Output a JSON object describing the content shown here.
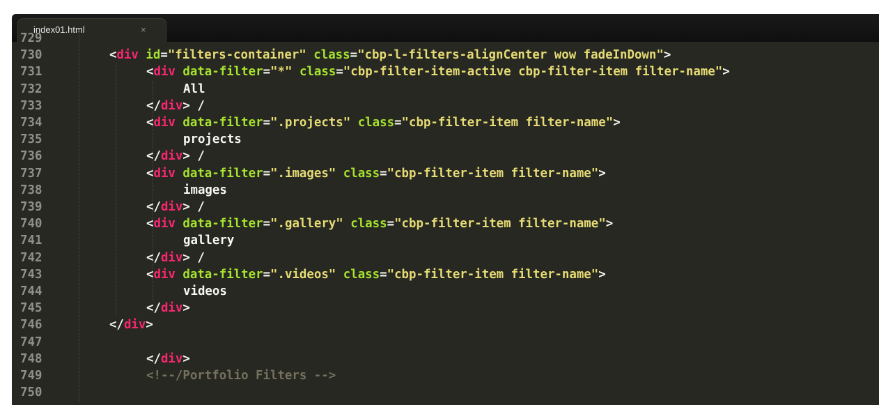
{
  "tab": {
    "title": "index01.html",
    "close": "×"
  },
  "editor": {
    "lines": [
      {
        "num": "729",
        "indent": 0,
        "tokens": []
      },
      {
        "num": "730",
        "indent": 1,
        "tokens": [
          {
            "t": "<",
            "c": "txt"
          },
          {
            "t": "div",
            "c": "tag"
          },
          {
            "t": " ",
            "c": "txt"
          },
          {
            "t": "id",
            "c": "attr"
          },
          {
            "t": "=",
            "c": "txt"
          },
          {
            "t": "\"filters-container\"",
            "c": "str"
          },
          {
            "t": " ",
            "c": "txt"
          },
          {
            "t": "class",
            "c": "attr"
          },
          {
            "t": "=",
            "c": "txt"
          },
          {
            "t": "\"cbp-l-filters-alignCenter wow fadeInDown\"",
            "c": "str"
          },
          {
            "t": ">",
            "c": "txt"
          }
        ]
      },
      {
        "num": "731",
        "indent": 2,
        "tokens": [
          {
            "t": "<",
            "c": "txt"
          },
          {
            "t": "div",
            "c": "tag"
          },
          {
            "t": " ",
            "c": "txt"
          },
          {
            "t": "data-filter",
            "c": "attr"
          },
          {
            "t": "=",
            "c": "txt"
          },
          {
            "t": "\"*\"",
            "c": "str"
          },
          {
            "t": " ",
            "c": "txt"
          },
          {
            "t": "class",
            "c": "attr"
          },
          {
            "t": "=",
            "c": "txt"
          },
          {
            "t": "\"cbp-filter-item-active cbp-filter-item filter-name\"",
            "c": "str"
          },
          {
            "t": ">",
            "c": "txt"
          }
        ]
      },
      {
        "num": "732",
        "indent": 3,
        "tokens": [
          {
            "t": "All",
            "c": "txt"
          }
        ]
      },
      {
        "num": "733",
        "indent": 2,
        "tokens": [
          {
            "t": "</",
            "c": "txt"
          },
          {
            "t": "div",
            "c": "tag"
          },
          {
            "t": "> /",
            "c": "txt"
          }
        ]
      },
      {
        "num": "734",
        "indent": 2,
        "tokens": [
          {
            "t": "<",
            "c": "txt"
          },
          {
            "t": "div",
            "c": "tag"
          },
          {
            "t": " ",
            "c": "txt"
          },
          {
            "t": "data-filter",
            "c": "attr"
          },
          {
            "t": "=",
            "c": "txt"
          },
          {
            "t": "\".projects\"",
            "c": "str"
          },
          {
            "t": " ",
            "c": "txt"
          },
          {
            "t": "class",
            "c": "attr"
          },
          {
            "t": "=",
            "c": "txt"
          },
          {
            "t": "\"cbp-filter-item filter-name\"",
            "c": "str"
          },
          {
            "t": ">",
            "c": "txt"
          }
        ]
      },
      {
        "num": "735",
        "indent": 3,
        "tokens": [
          {
            "t": "projects",
            "c": "txt"
          }
        ]
      },
      {
        "num": "736",
        "indent": 2,
        "tokens": [
          {
            "t": "</",
            "c": "txt"
          },
          {
            "t": "div",
            "c": "tag"
          },
          {
            "t": "> /",
            "c": "txt"
          }
        ]
      },
      {
        "num": "737",
        "indent": 2,
        "tokens": [
          {
            "t": "<",
            "c": "txt"
          },
          {
            "t": "div",
            "c": "tag"
          },
          {
            "t": " ",
            "c": "txt"
          },
          {
            "t": "data-filter",
            "c": "attr"
          },
          {
            "t": "=",
            "c": "txt"
          },
          {
            "t": "\".images\"",
            "c": "str"
          },
          {
            "t": " ",
            "c": "txt"
          },
          {
            "t": "class",
            "c": "attr"
          },
          {
            "t": "=",
            "c": "txt"
          },
          {
            "t": "\"cbp-filter-item filter-name\"",
            "c": "str"
          },
          {
            "t": ">",
            "c": "txt"
          }
        ]
      },
      {
        "num": "738",
        "indent": 3,
        "tokens": [
          {
            "t": "images",
            "c": "txt"
          }
        ]
      },
      {
        "num": "739",
        "indent": 2,
        "tokens": [
          {
            "t": "</",
            "c": "txt"
          },
          {
            "t": "div",
            "c": "tag"
          },
          {
            "t": "> /",
            "c": "txt"
          }
        ]
      },
      {
        "num": "740",
        "indent": 2,
        "tokens": [
          {
            "t": "<",
            "c": "txt"
          },
          {
            "t": "div",
            "c": "tag"
          },
          {
            "t": " ",
            "c": "txt"
          },
          {
            "t": "data-filter",
            "c": "attr"
          },
          {
            "t": "=",
            "c": "txt"
          },
          {
            "t": "\".gallery\"",
            "c": "str"
          },
          {
            "t": " ",
            "c": "txt"
          },
          {
            "t": "class",
            "c": "attr"
          },
          {
            "t": "=",
            "c": "txt"
          },
          {
            "t": "\"cbp-filter-item filter-name\"",
            "c": "str"
          },
          {
            "t": ">",
            "c": "txt"
          }
        ]
      },
      {
        "num": "741",
        "indent": 3,
        "tokens": [
          {
            "t": "gallery",
            "c": "txt"
          }
        ]
      },
      {
        "num": "742",
        "indent": 2,
        "tokens": [
          {
            "t": "</",
            "c": "txt"
          },
          {
            "t": "div",
            "c": "tag"
          },
          {
            "t": "> /",
            "c": "txt"
          }
        ]
      },
      {
        "num": "743",
        "indent": 2,
        "tokens": [
          {
            "t": "<",
            "c": "txt"
          },
          {
            "t": "div",
            "c": "tag"
          },
          {
            "t": " ",
            "c": "txt"
          },
          {
            "t": "data-filter",
            "c": "attr"
          },
          {
            "t": "=",
            "c": "txt"
          },
          {
            "t": "\".videos\"",
            "c": "str"
          },
          {
            "t": " ",
            "c": "txt"
          },
          {
            "t": "class",
            "c": "attr"
          },
          {
            "t": "=",
            "c": "txt"
          },
          {
            "t": "\"cbp-filter-item filter-name\"",
            "c": "str"
          },
          {
            "t": ">",
            "c": "txt"
          }
        ]
      },
      {
        "num": "744",
        "indent": 3,
        "tokens": [
          {
            "t": "videos",
            "c": "txt"
          }
        ]
      },
      {
        "num": "745",
        "indent": 2,
        "tokens": [
          {
            "t": "</",
            "c": "txt"
          },
          {
            "t": "div",
            "c": "tag"
          },
          {
            "t": ">",
            "c": "txt"
          }
        ]
      },
      {
        "num": "746",
        "indent": 1,
        "tokens": [
          {
            "t": "</",
            "c": "txt"
          },
          {
            "t": "div",
            "c": "tag"
          },
          {
            "t": ">",
            "c": "txt"
          }
        ]
      },
      {
        "num": "747",
        "indent": 0,
        "tokens": []
      },
      {
        "num": "748",
        "indent": 2,
        "tokens": [
          {
            "t": "</",
            "c": "txt"
          },
          {
            "t": "div",
            "c": "tag"
          },
          {
            "t": ">",
            "c": "txt"
          }
        ]
      },
      {
        "num": "749",
        "indent": 2,
        "tokens": [
          {
            "t": "<!--/Portfolio Filters -->",
            "c": "cmt"
          }
        ]
      },
      {
        "num": "750",
        "indent": 0,
        "tokens": []
      }
    ]
  },
  "colors": {
    "background": "#272822",
    "tag": "#f92672",
    "attribute": "#a6e22e",
    "string": "#e6db74",
    "text": "#f8f8f2",
    "comment": "#75715e",
    "gutter": "#90908a"
  }
}
